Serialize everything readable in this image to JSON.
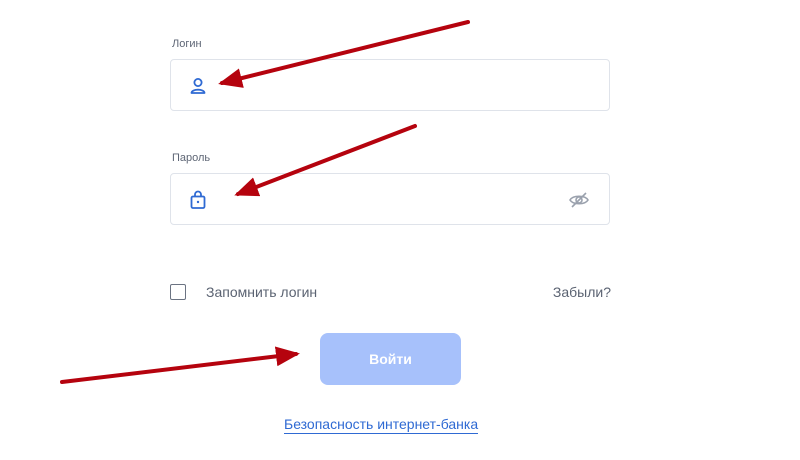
{
  "login": {
    "label": "Логин",
    "icon": "user-icon",
    "value": "",
    "placeholder": ""
  },
  "password": {
    "label": "Пароль",
    "icon": "lock-icon",
    "toggle_icon": "eye-hidden-icon",
    "value": "",
    "placeholder": ""
  },
  "remember": {
    "label": "Запомнить логин",
    "checked": false
  },
  "forgot_label": "Забыли?",
  "submit_label": "Войти",
  "security_link": "Безопасность интернет-банка",
  "colors": {
    "accent": "#2f6ad3",
    "button_disabled": "#a7c1fb",
    "annotation_arrow": "#b5030e",
    "border": "#dfe3ea"
  }
}
